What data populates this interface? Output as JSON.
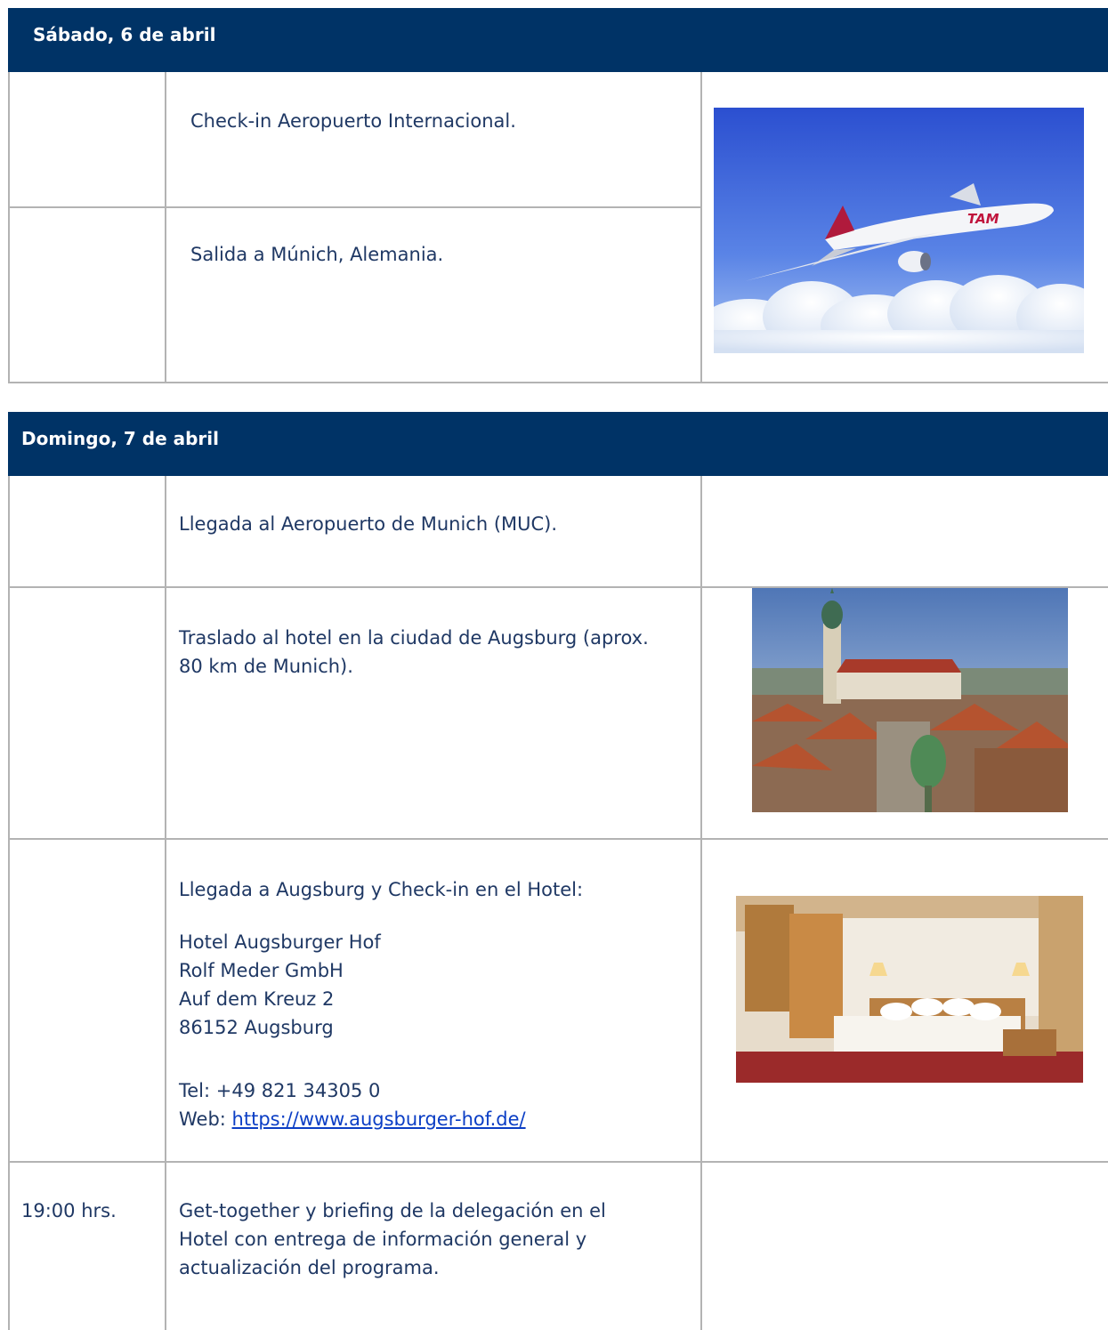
{
  "day1": {
    "header": "Sábado, 6 de abril",
    "rows": [
      {
        "time": "",
        "text": "Check-in Aeropuerto Internacional."
      },
      {
        "time": "",
        "text": "Salida a Múnich, Alemania."
      }
    ],
    "image": {
      "icon": "airplane-photo",
      "brand_text": "TAM"
    }
  },
  "day2": {
    "header": "Domingo, 7 de abril",
    "rows": [
      {
        "time": "",
        "text": "Llegada al Aeropuerto de Munich (MUC)."
      },
      {
        "time": "",
        "text_line1": "Traslado al hotel en la ciudad de Augsburg (aprox.",
        "text_line2": "80 km de Munich)."
      },
      {
        "time": "",
        "intro": "Llegada a Augsburg y Check-in en el Hotel:",
        "address": [
          "Hotel Augsburger Hof",
          "Rolf Meder GmbH",
          "Auf dem Kreuz 2",
          "86152 Augsburg"
        ],
        "tel": "Tel: +49 821 34305 0",
        "web_label": "Web: ",
        "web_url": "https://www.augsburger-hof.de/"
      },
      {
        "time": "19:00 hrs.",
        "lines": [
          "Get-together y briefing de la delegación en el",
          "Hotel con entrega de información general y",
          "actualización del programa."
        ]
      }
    ]
  },
  "colors": {
    "header_bg": "#003366",
    "text": "#1f3864",
    "border": "#b3b3b3",
    "link": "#0b3ec5"
  }
}
